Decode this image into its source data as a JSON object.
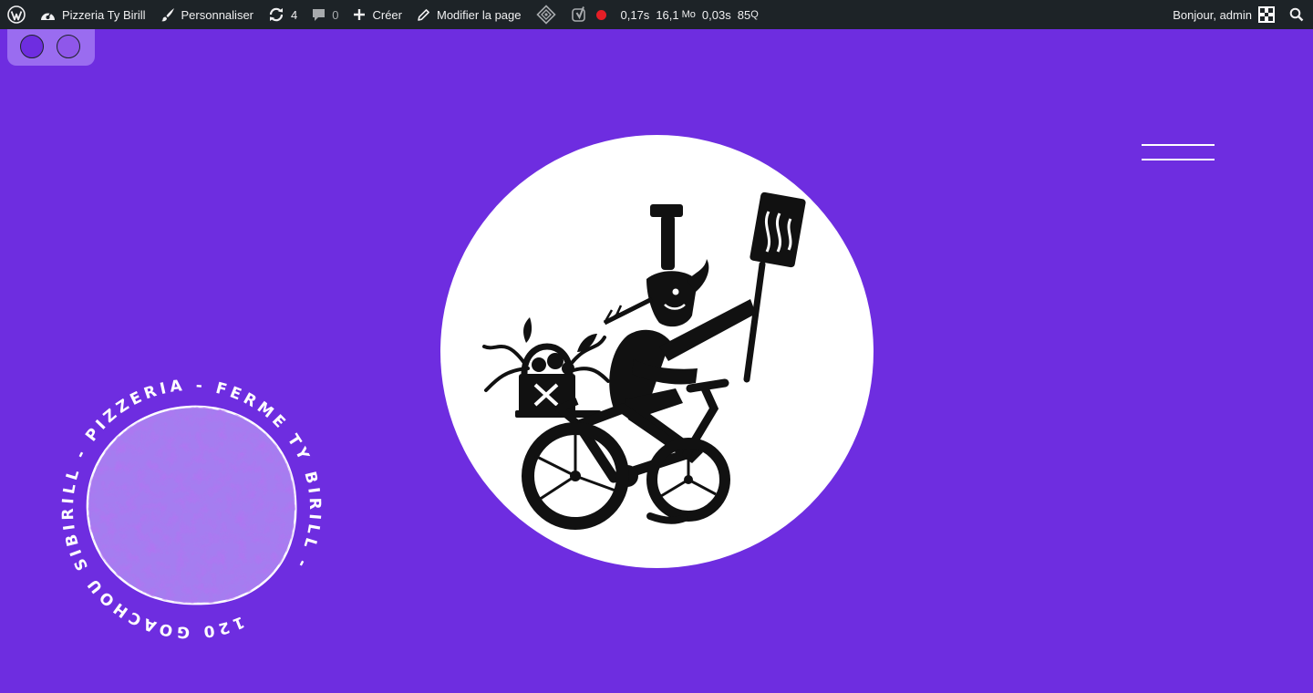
{
  "admin_bar": {
    "site_name": "Pizzeria Ty Birill",
    "customize_label": "Personnaliser",
    "updates_count": "4",
    "comments_count": "0",
    "new_label": "Créer",
    "edit_label": "Modifier la page",
    "qm": {
      "time": "0,17s",
      "memory": "16,1",
      "memory_unit": "Mo",
      "db_time": "0,03s",
      "queries": "85",
      "queries_unit": "Q"
    },
    "greeting": "Bonjour, admin"
  },
  "icons": {
    "wp_logo": "wordpress-icon",
    "dashboard": "dashboard-icon",
    "customize": "brush-icon",
    "updates": "refresh-icon",
    "comments": "comment-icon",
    "new": "plus-icon",
    "edit": "pencil-icon",
    "diamond": "diamond-icon",
    "yoast": "yoast-icon",
    "record": "record-dot-icon",
    "search": "search-icon",
    "menu": "hamburger-icon"
  },
  "badge": {
    "ring_text": "120 GOACHOU SIBIRILL - PIZZERIA - FERME TY BIRILL -"
  },
  "colors": {
    "background": "#6e2de0",
    "admin_bar": "#1d2327",
    "switch_panel": "#9a6cf0",
    "badge_pizza": "#a57df0",
    "record": "#e41e26"
  }
}
